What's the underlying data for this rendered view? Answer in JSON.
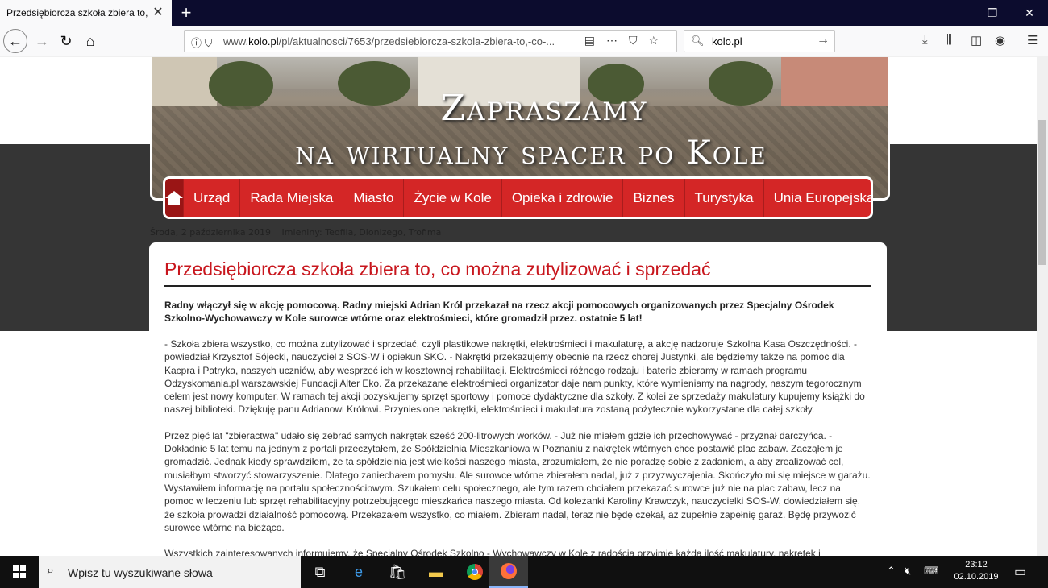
{
  "browser": {
    "tab_title": "Przedsiębiorcza szkoła zbiera to, co",
    "url_prefix": "www.",
    "url_domain": "kolo.pl",
    "url_path": "/pl/aktualnosci/7653/przedsiebiorcza-szkola-zbiera-to,-co-...",
    "search_value": "kolo.pl"
  },
  "banner": {
    "line1": "Zapraszamy",
    "line2": "na wirtualny spacer po Kole"
  },
  "menu": {
    "items": [
      "Urząd",
      "Rada Miejska",
      "Miasto",
      "Życie w Kole",
      "Opieka i zdrowie",
      "Biznes",
      "Turystyka",
      "Unia Europejska"
    ]
  },
  "info": {
    "date": "Środa, 2 października 2019",
    "names": "Imieniny: Teofila, Dionizego, Trofima"
  },
  "article": {
    "title": "Przedsiębiorcza szkoła zbiera to, co można zutylizować i sprzedać",
    "lead": "Radny włączył się w akcję pomocową. Radny miejski Adrian Król przekazał na rzecz akcji pomocowych organizowanych przez Specjalny Ośrodek Szkolno-Wychowawczy w Kole surowce wtórne oraz elektrośmieci, które gromadził przez. ostatnie 5 lat!",
    "p1": "- Szkoła zbiera wszystko, co można zutylizować i sprzedać, czyli plastikowe nakrętki, elektrośmieci i makulaturę, a akcję nadzoruje Szkolna Kasa Oszczędności. - powiedział Krzysztof Sójecki, nauczyciel z SOS-W i opiekun SKO. - Nakrętki przekazujemy obecnie na rzecz chorej Justynki, ale będziemy także na pomoc dla Kacpra i Patryka, naszych uczniów, aby wesprzeć ich w kosztownej rehabilitacji. Elektrośmieci różnego rodzaju i baterie zbieramy w ramach programu Odzyskomania.pl warszawskiej Fundacji Alter Eko. Za przekazane elektrośmieci organizator daje nam punkty, które wymieniamy na nagrody, naszym tegorocznym celem jest nowy komputer. W ramach tej akcji pozyskujemy sprzęt sportowy i pomoce dydaktyczne dla szkoły. Z kolei ze sprzedaży makulatury kupujemy książki do naszej biblioteki. Dziękuję panu Adrianowi Królowi. Przyniesione nakrętki, elektrośmieci i makulatura zostaną pożytecznie wykorzystane dla całej szkoły.",
    "p2": "Przez pięć lat \"zbieractwa\" udało się zebrać samych nakrętek sześć 200-litrowych worków. - Już nie miałem gdzie ich przechowywać - przyznał darczyńca. - Dokładnie 5 lat temu na jednym z portali przeczytałem, że Spółdzielnia Mieszkaniowa w Poznaniu z nakrętek wtórnych chce postawić plac zabaw. Zacząłem je gromadzić. Jednak kiedy sprawdziłem, że ta spółdzielnia jest wielkości naszego miasta, zrozumiałem, że nie poradzę sobie z zadaniem, a aby zrealizować cel, musiałbym stworzyć stowarzyszenie. Dlatego zaniechałem pomysłu. Ale surowce wtórne zbierałem nadal, już z przyzwyczajenia. Skończyło mi się miejsce w garażu. Wystawiłem informację na portalu społecznościowym. Szukałem celu społecznego, ale tym razem chciałem przekazać surowce już nie na plac zabaw, lecz na pomoc w leczeniu lub sprzęt rehabilitacyjny potrzebującego mieszkańca naszego miasta. Od koleżanki Karoliny Krawczyk, nauczycielki SOS-W, dowiedziałem się, że szkoła prowadzi działalność pomocową. Przekazałem wszystko, co miałem. Zbieram nadal, teraz nie będę czekał, aż zupełnie zapełnię garaż. Będę przywozić surowce wtórne na bieżąco.",
    "p3": "Wszystkich zainteresowanych informujemy, że Specjalny Ośrodek Szkolno - Wychowawczy w Kole z radością przyjmie każdą ilość makulatury, nakrętek i elektrośmieci, właściwie dysponując tymi surowcami, i pięknie podziękuje ofiarodawcy."
  },
  "taskbar": {
    "search_placeholder": "Wpisz tu wyszukiwane słowa",
    "time": "23:12",
    "date": "02.10.2019"
  }
}
